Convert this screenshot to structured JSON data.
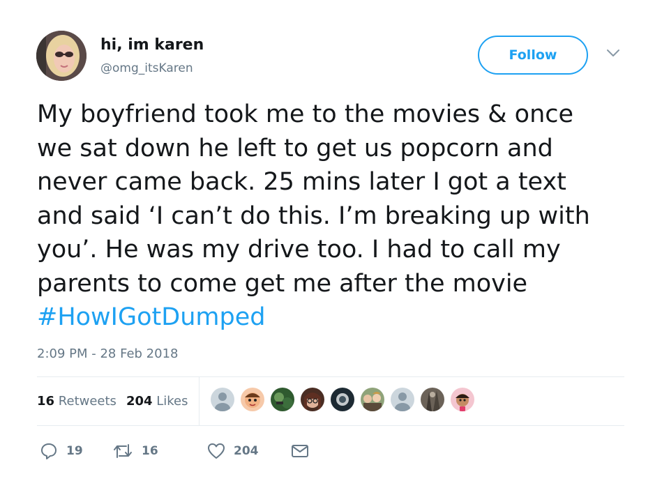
{
  "author": {
    "display_name": "hi, im karen",
    "handle": "@omg_itsKaren"
  },
  "follow_label": "Follow",
  "tweet": {
    "lines": [
      "My boyfriend took me to the movies & once",
      "we sat down he left to get us popcorn and",
      "never came back. 25 mins later I got a text",
      "and said ‘I can’t do this. I’m breaking up with",
      "you’. He was my drive too. I had to call my",
      "parents to come get me after the movie"
    ],
    "hashtag": "#HowIGotDumped",
    "timestamp": "2:09 PM - 28 Feb 2018"
  },
  "stats": {
    "retweet_count": "16",
    "retweet_label": "Retweets",
    "like_count": "204",
    "like_label": "Likes"
  },
  "liker_avatars": [
    "default",
    "cartoon",
    "green",
    "glasses",
    "dark",
    "group",
    "default",
    "tree",
    "cartoon-pink"
  ],
  "actions": {
    "reply_count": "19",
    "retweet_count": "16",
    "like_count": "204"
  },
  "colors": {
    "accent": "#1da1f2",
    "text": "#14171a",
    "secondary": "#657786",
    "divider": "#e6ecf0"
  }
}
